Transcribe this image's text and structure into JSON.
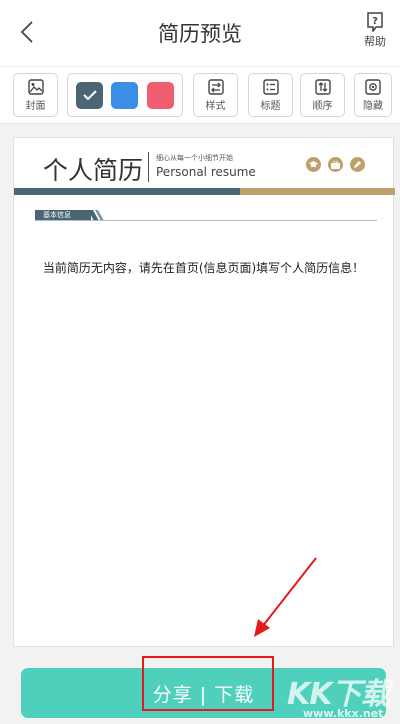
{
  "header": {
    "title": "简历预览",
    "help_label": "帮助"
  },
  "toolbar": {
    "cover_label": "封面",
    "style_label": "样式",
    "heading_label": "标题",
    "order_label": "顺序",
    "hide_label": "隐藏",
    "swatches": [
      "#4a6675",
      "#3a8ee6",
      "#f05d70"
    ]
  },
  "resume": {
    "title": "个人简历",
    "slogan": "细心从每一个小细节开始",
    "subtitle": "Personal resume",
    "section": "基本信息",
    "empty_message": "当前简历无内容，请先在首页(信息页面)填写个人简历信息！"
  },
  "share": {
    "label": "分享 | 下载"
  },
  "watermark": {
    "text": "KK下载",
    "url": "www.kkx.net"
  },
  "colors": {
    "accent": "#4fd0bd",
    "primary": "#4a6675",
    "gold": "#bfa06a",
    "annotation": "#e31b1b"
  }
}
